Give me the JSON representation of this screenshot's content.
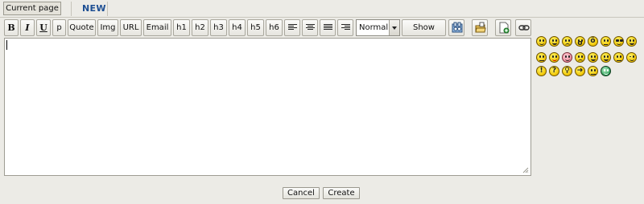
{
  "tabs": {
    "current_page": "Current page",
    "new": "NEW"
  },
  "toolbar": {
    "bold": "B",
    "italic": "I",
    "underline": "U",
    "p": "p",
    "quote": "Quote",
    "img": "Img",
    "url": "URL",
    "email": "Email",
    "h1": "h1",
    "h2": "h2",
    "h3": "h3",
    "h4": "h4",
    "h5": "h5",
    "h6": "h6",
    "font_size_value": "Normal",
    "show_color": "Show color",
    "icons": [
      "align-left-icon",
      "align-center-icon",
      "align-justify-icon",
      "align-right-icon",
      "preview-icon",
      "open-folder-icon",
      "new-document-icon",
      "link-icon"
    ]
  },
  "editor": {
    "value": ""
  },
  "smileys": {
    "count": 20
  },
  "actions": {
    "cancel": "Cancel",
    "create": "Create"
  }
}
